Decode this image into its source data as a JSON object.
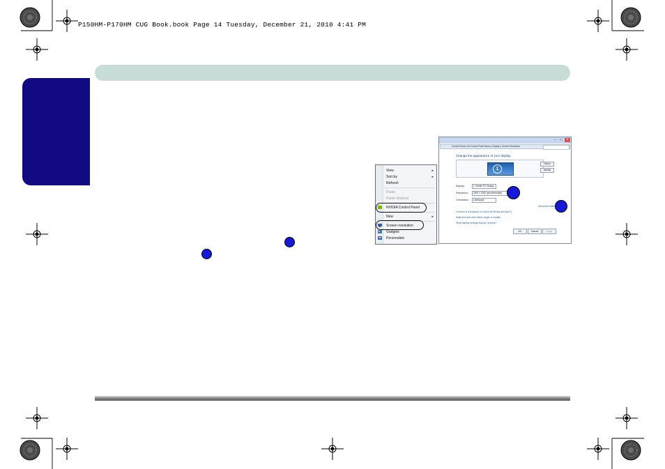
{
  "header": {
    "print_line": "P150HM-P170HM CUG Book.book  Page 14  Tuesday, December 21, 2010  4:41 PM"
  },
  "context_menu": {
    "items": [
      {
        "label": "View",
        "has_submenu": true,
        "disabled": false
      },
      {
        "label": "Sort by",
        "has_submenu": true,
        "disabled": false
      },
      {
        "label": "Refresh",
        "has_submenu": false,
        "disabled": false
      },
      {
        "label": "Paste",
        "has_submenu": false,
        "disabled": true
      },
      {
        "label": "Paste shortcut",
        "has_submenu": false,
        "disabled": true
      },
      {
        "label": "NVIDIA Control Panel",
        "has_submenu": false,
        "disabled": false
      },
      {
        "label": "New",
        "has_submenu": true,
        "disabled": false
      },
      {
        "label": "Screen resolution",
        "has_submenu": false,
        "disabled": false
      },
      {
        "label": "Gadgets",
        "has_submenu": false,
        "disabled": false
      },
      {
        "label": "Personalize",
        "has_submenu": false,
        "disabled": false
      }
    ]
  },
  "screen_resolution_window": {
    "address": "Control Panel ▸ All Control Panel Items ▸ Display ▸ Screen Resolution",
    "heading": "Change the appearance of your display",
    "monitor_number": "1",
    "detect_label": "Detect",
    "identify_label": "Identify",
    "display_label": "Display:",
    "display_value": "1. Mobile PC Display",
    "resolution_label": "Resolution:",
    "resolution_value": "1920 × 1080 (recommended)",
    "orientation_label": "Orientation:",
    "orientation_value": "Landscape",
    "advanced_link": "Advanced settings",
    "links": [
      "Connect to a projector (or press the ⊞ key and tap P)",
      "Make text and other items larger or smaller",
      "What display settings should I choose?"
    ],
    "ok_label": "OK",
    "cancel_label": "Cancel",
    "apply_label": "Apply"
  },
  "colors": {
    "side_tab": "#120a82",
    "top_band": "#c9ddd8",
    "badge": "#1818d8"
  }
}
